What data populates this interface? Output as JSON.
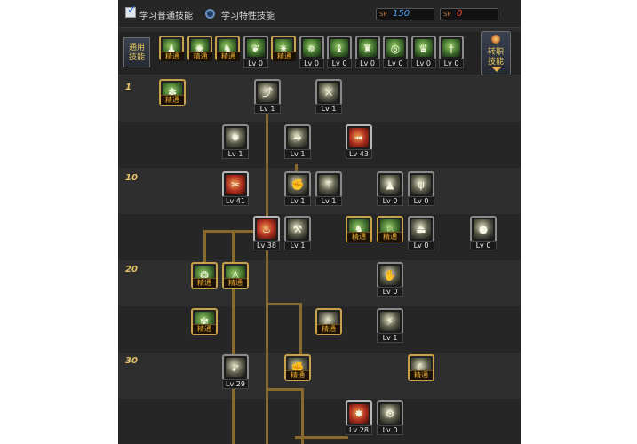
{
  "header": {
    "radio_normal_label": "学习普通技能",
    "radio_special_label": "学习特性技能",
    "sp_blue_tag": "SP",
    "sp_blue_value": "150",
    "sp_red_tag": "SP",
    "sp_red_value": "0"
  },
  "skill_bar": {
    "common_tab_label": [
      "通用",
      "技能"
    ],
    "swap_tab_label": [
      "转职",
      "技能"
    ],
    "slots": [
      {
        "tag": "精通",
        "icon": "crouching-figure-icon"
      },
      {
        "tag": "精通",
        "icon": "swirl-figure-icon"
      },
      {
        "tag": "精通",
        "icon": "running-figure-icon"
      },
      {
        "tag": "Lv 0",
        "icon": "wings-icon"
      },
      {
        "tag": "精通",
        "icon": "sparkle-burst-icon"
      },
      {
        "tag": "Lv 0",
        "icon": "star-burst-icon"
      },
      {
        "tag": "Lv 0",
        "icon": "jumping-figure-icon"
      },
      {
        "tag": "Lv 0",
        "icon": "kicking-figure-icon"
      },
      {
        "tag": "Lv 0",
        "icon": "shield-ring-icon"
      },
      {
        "tag": "Lv 0",
        "icon": "arms-raised-figure-icon"
      },
      {
        "tag": "Lv 0",
        "icon": "sword-icon"
      }
    ]
  },
  "tree": {
    "level_markers": [
      "1",
      "10",
      "20",
      "30"
    ],
    "skills": [
      {
        "id": "s1",
        "tag": "精通",
        "icon": "spin-attack-icon",
        "style": "green"
      },
      {
        "id": "s2",
        "tag": "Lv 1",
        "icon": "upper-arrow-icon",
        "style": "dark"
      },
      {
        "id": "s3",
        "tag": "Lv 1",
        "icon": "kick-icon",
        "style": "dark"
      },
      {
        "id": "s4",
        "tag": "Lv 1",
        "icon": "burst-icon",
        "style": "dark"
      },
      {
        "id": "s5",
        "tag": "Lv 1",
        "icon": "dash-icon",
        "style": "dark"
      },
      {
        "id": "s6",
        "tag": "Lv 43",
        "icon": "fire-dash-icon",
        "style": "red"
      },
      {
        "id": "s7",
        "tag": "Lv 41",
        "icon": "fire-slash-icon",
        "style": "red"
      },
      {
        "id": "s8",
        "tag": "Lv 1",
        "icon": "slam-icon",
        "style": "dark"
      },
      {
        "id": "s9",
        "tag": "Lv 1",
        "icon": "blade-icon",
        "style": "dark"
      },
      {
        "id": "s10",
        "tag": "Lv 0",
        "icon": "stomp-icon",
        "style": "dark"
      },
      {
        "id": "s11",
        "tag": "Lv 0",
        "icon": "claw-icon",
        "style": "dark"
      },
      {
        "id": "s12",
        "tag": "Lv 38",
        "icon": "flame-figure-icon",
        "style": "red"
      },
      {
        "id": "s13",
        "tag": "Lv 1",
        "icon": "hammer-icon",
        "style": "dark"
      },
      {
        "id": "s14",
        "tag": "精通",
        "icon": "leap-figure-icon",
        "style": "green"
      },
      {
        "id": "s15",
        "tag": "精通",
        "icon": "charge-figure-icon",
        "style": "green"
      },
      {
        "id": "s16",
        "tag": "Lv 0",
        "icon": "ground-strike-icon",
        "style": "dark"
      },
      {
        "id": "s17",
        "tag": "Lv 0",
        "icon": "bomb-icon",
        "style": "dark"
      },
      {
        "id": "s18",
        "tag": "精通",
        "icon": "whirlwind-icon",
        "style": "green"
      },
      {
        "id": "s19",
        "tag": "精通",
        "icon": "sprint-figure-icon",
        "style": "green"
      },
      {
        "id": "s20",
        "tag": "Lv 0",
        "icon": "gauntlet-icon",
        "style": "dark"
      },
      {
        "id": "s21",
        "tag": "精通",
        "icon": "tornado-kick-icon",
        "style": "green"
      },
      {
        "id": "s22",
        "tag": "精通",
        "icon": "uppercut-icon",
        "style": "dark"
      },
      {
        "id": "s23",
        "tag": "Lv 1",
        "icon": "flip-kick-icon",
        "style": "dark"
      },
      {
        "id": "s24",
        "tag": "Lv 29",
        "icon": "spear-thrust-icon",
        "style": "dark"
      },
      {
        "id": "s25",
        "tag": "精通",
        "icon": "ground-punch-icon",
        "style": "dark"
      },
      {
        "id": "s26",
        "tag": "精通",
        "icon": "crescent-slash-icon",
        "style": "dark"
      },
      {
        "id": "s27",
        "tag": "Lv 28",
        "icon": "explosion-icon",
        "style": "red"
      },
      {
        "id": "s28",
        "tag": "Lv 0",
        "icon": "cannon-icon",
        "style": "dark"
      }
    ]
  }
}
